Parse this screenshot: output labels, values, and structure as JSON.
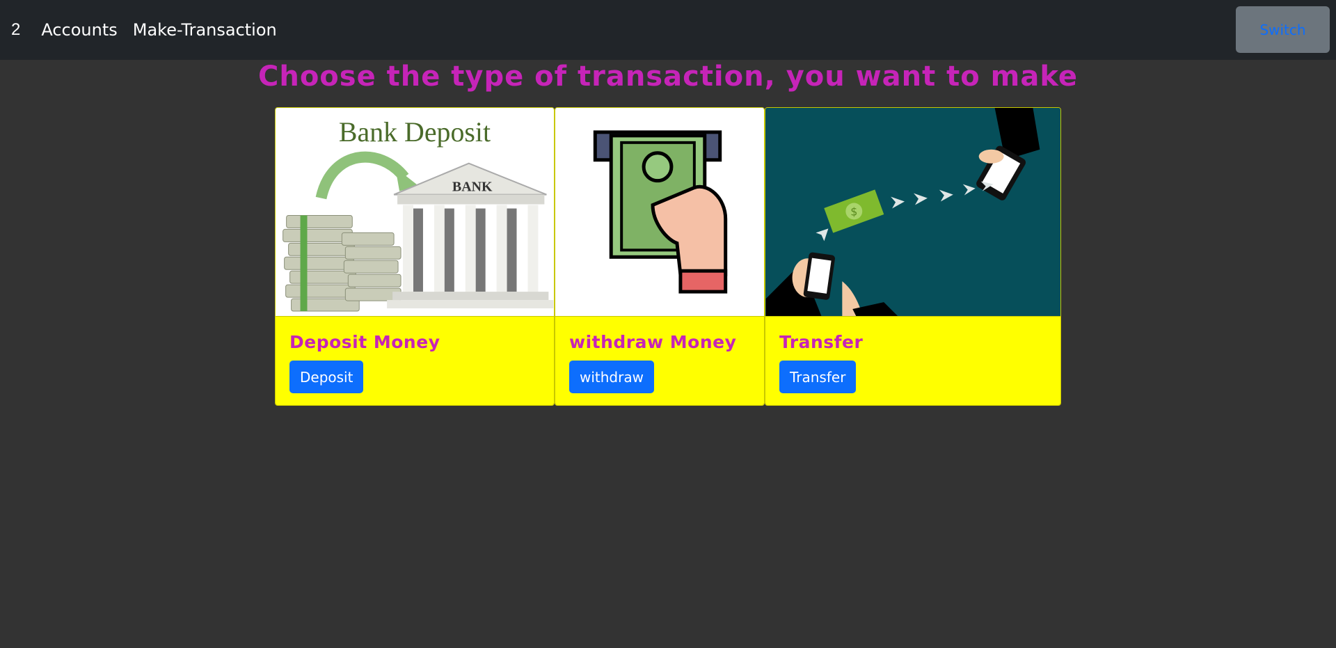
{
  "navbar": {
    "brand": "2",
    "links": [
      "Accounts",
      "Make-Transaction"
    ],
    "switch_label": "Switch"
  },
  "page": {
    "heading": "Choose the type of transaction, you want to make"
  },
  "cards": [
    {
      "image_icon": "bank-deposit-illustration",
      "image_text_title": "Bank Deposit",
      "image_text_bank": "BANK",
      "title": "Deposit Money",
      "button": "Deposit"
    },
    {
      "image_icon": "atm-withdraw-illustration",
      "title": "withdraw Money",
      "button": "withdraw"
    },
    {
      "image_icon": "mobile-transfer-illustration",
      "title": "Transfer",
      "button": "Transfer"
    }
  ],
  "colors": {
    "accent": "#c624b8",
    "card_body": "#ffff00",
    "button": "#0d6efd",
    "navbar": "#212529",
    "background": "#333333"
  }
}
